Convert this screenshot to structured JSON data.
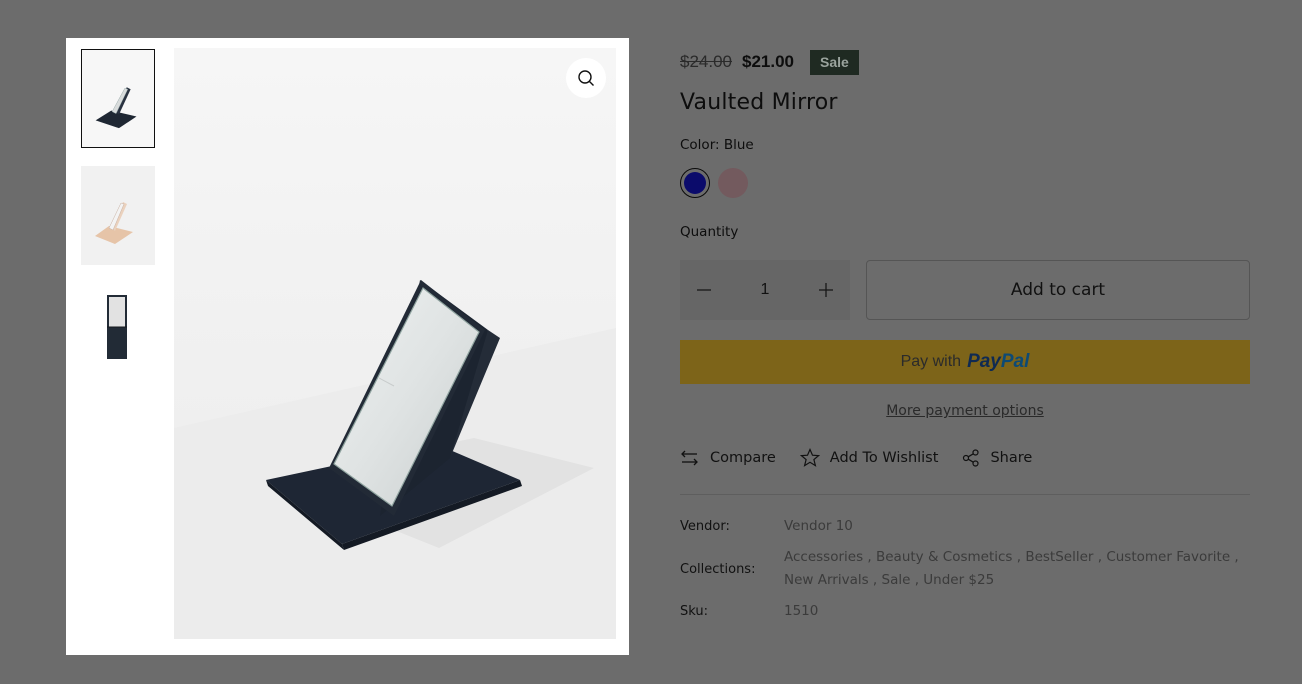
{
  "product": {
    "compare_price": "$24.00",
    "price": "$21.00",
    "badge": "Sale",
    "title": "Vaulted Mirror",
    "color_label": "Color: Blue",
    "swatches": [
      {
        "name": "Blue",
        "color": "#0b0b6b",
        "selected": true
      },
      {
        "name": "Pink",
        "color": "#735a5e",
        "selected": false
      }
    ],
    "quantity_label": "Quantity",
    "quantity": "1",
    "add_to_cart": "Add to cart",
    "paypal": {
      "prefix": "Pay with",
      "brand_a": "Pay",
      "brand_b": "Pal"
    },
    "more_payment": "More payment options",
    "actions": {
      "compare": "Compare",
      "wishlist": "Add To Wishlist",
      "share": "Share"
    },
    "meta": {
      "vendor_key": "Vendor:",
      "vendor_val": "Vendor 10",
      "collections_key": "Collections:",
      "collections_val": "Accessories , Beauty & Cosmetics , BestSeller , Customer Favorite , New Arrivals , Sale , Under $25",
      "sku_key": "Sku:",
      "sku_val": "1510"
    }
  },
  "gallery": {
    "thumbnails": [
      "mirror-black-angle",
      "mirror-pink-angle",
      "mirror-black-flat"
    ],
    "active_index": 0,
    "zoom_icon": "magnifier-icon"
  },
  "colors": {
    "overlay_bg": "#6c6c6c",
    "sale_badge_bg": "#1f2a22",
    "paypal_bg": "#7d6419"
  }
}
